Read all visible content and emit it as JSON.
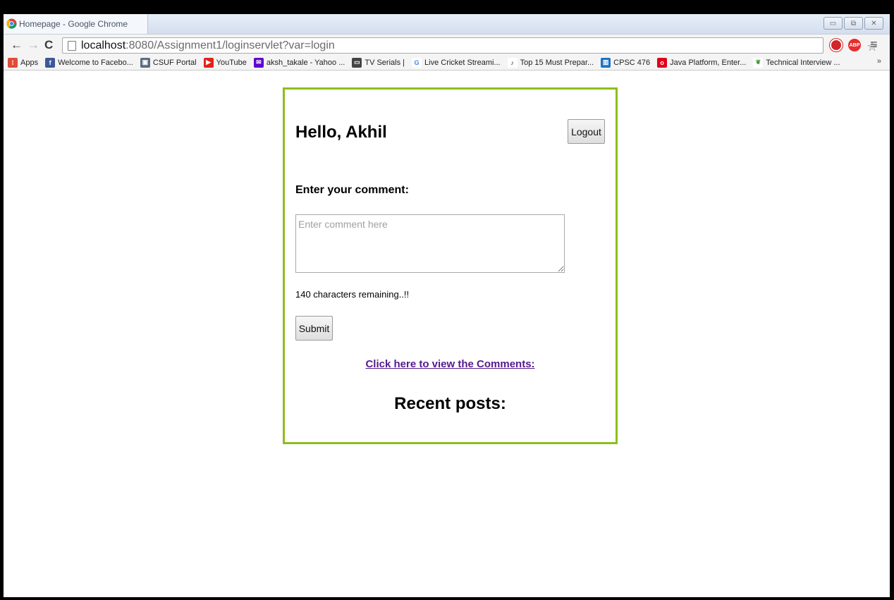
{
  "browser": {
    "tab_title": "Homepage - Google Chrome",
    "url_host": "localhost",
    "url_rest": ":8080/Assignment1/loginservlet?var=login",
    "bookmarks": [
      {
        "label": "Apps",
        "icon": "apps-icon",
        "color": "#e04b3a"
      },
      {
        "label": "Welcome to Facebo...",
        "icon": "facebook-icon",
        "color": "#3b5998"
      },
      {
        "label": "CSUF Portal",
        "icon": "portal-icon",
        "color": "#5b6b80"
      },
      {
        "label": "YouTube",
        "icon": "youtube-icon",
        "color": "#e62117"
      },
      {
        "label": "aksh_takale - Yahoo ...",
        "icon": "yahoo-mail-icon",
        "color": "#5f01d1"
      },
      {
        "label": "TV Serials |",
        "icon": "tv-serials-icon",
        "color": "#444444"
      },
      {
        "label": "Live Cricket Streami...",
        "icon": "google-icon",
        "color": "#4285f4"
      },
      {
        "label": "Top 15 Must Prepar...",
        "icon": "music-icon",
        "color": "#222222"
      },
      {
        "label": "CPSC 476",
        "icon": "board-icon",
        "color": "#1a73c7"
      },
      {
        "label": "Java Platform, Enter...",
        "icon": "oracle-icon",
        "color": "#e1001a"
      },
      {
        "label": "Technical Interview ...",
        "icon": "leaf-icon",
        "color": "#3d8f2f"
      }
    ],
    "bookmarks_more": "»",
    "accent_color": "#8dbe1c"
  },
  "page": {
    "greeting": "Hello, Akhil",
    "logout_label": "Logout",
    "comment_label": "Enter your comment:",
    "comment_placeholder": "Enter comment here",
    "remaining_text": "140 characters remaining..!!",
    "submit_label": "Submit",
    "view_link": "Click here to view the Comments:",
    "recent_heading": "Recent posts:"
  }
}
